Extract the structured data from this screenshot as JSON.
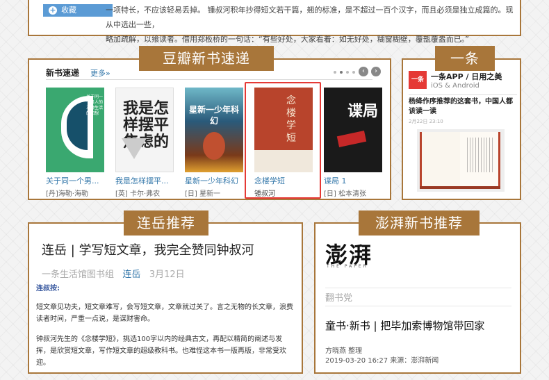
{
  "top": {
    "fav_label": "收藏",
    "intro_line1": "一项特长，不应该轻易丢掉。 锺叔河积年抄得短文若干篇，翘的标准，是不超过一百个汉字，而且必须是独立成篇的。现从中选出一些，",
    "intro_line2": "略加疏解，以飨读者。借用郑板桥的一句话：“有些好处，大家看着：如无好处，糊窗糊壁，覆瓿覆盎而已。”"
  },
  "douban": {
    "tag": "豆瓣新书速递",
    "header": "新书速递",
    "more": "更多»",
    "books": [
      {
        "title": "关于同一个男...",
        "author": "[丹]海勒·海勒",
        "cover": "#3aa870",
        "cover_text": "关于同一个男人的三种生活的回想"
      },
      {
        "title": "我是怎样摆平...",
        "author": "[英] 卡尔·弗农",
        "cover": "#f4f4f4",
        "cover_text": "我是怎样摆平焦虑的"
      },
      {
        "title": "星新一少年科幻",
        "author": "[日] 星新一",
        "cover": "#2a5a7a",
        "cover_text": "星新一少年科幻"
      },
      {
        "title": "念楼学短",
        "author": "锺叔河",
        "cover": "#b8442c",
        "cover_text": "念楼学短"
      },
      {
        "title": "谍局 1",
        "author": "[日] 松本清张",
        "cover": "#1a1a1a",
        "cover_text": "谍局"
      }
    ]
  },
  "yitiao": {
    "tag": "一条",
    "app_name": "一条APP / 日用之美",
    "platforms": "iOS & Android",
    "logo_text": "一条",
    "headline": "杨绛作序推荐的这套书，中国人都该读一读",
    "date": "2月22日 23:10"
  },
  "lianyue": {
    "tag": "连岳推荐",
    "title": "连岳 | 学写短文章，我完全赞同钟叔河",
    "source": "一条生活馆图书组",
    "author": "连岳",
    "date": "3月12日",
    "label": "连叔按:",
    "para1": "短文章见功夫，短文章难写，会写短文章，文章就过关了。言之无物的长文章，浪费读者时间，严重一点说，是谋财害命。",
    "para2": "钟叔河先生的《念楼学短》，挑选100字以内的经典古文，再配以精简的阐述与发挥，是欣赏短文章，写作短文章的超级教科书。也难怪这本书一版再版，非常受欢迎。"
  },
  "pengpai": {
    "tag": "澎湃新书推荐",
    "logo": "澎湃",
    "logo_sub": "THE PAPER",
    "channel": "翻书党",
    "title": "童书·新书 | 把毕加索博物馆带回家",
    "author": "方晓燕 整理",
    "meta": "2019-03-20 16:27  来源：澎湃新闻"
  },
  "colors": {
    "accent": "#a8763a",
    "link": "#3377aa",
    "highlight": "#e53935"
  }
}
